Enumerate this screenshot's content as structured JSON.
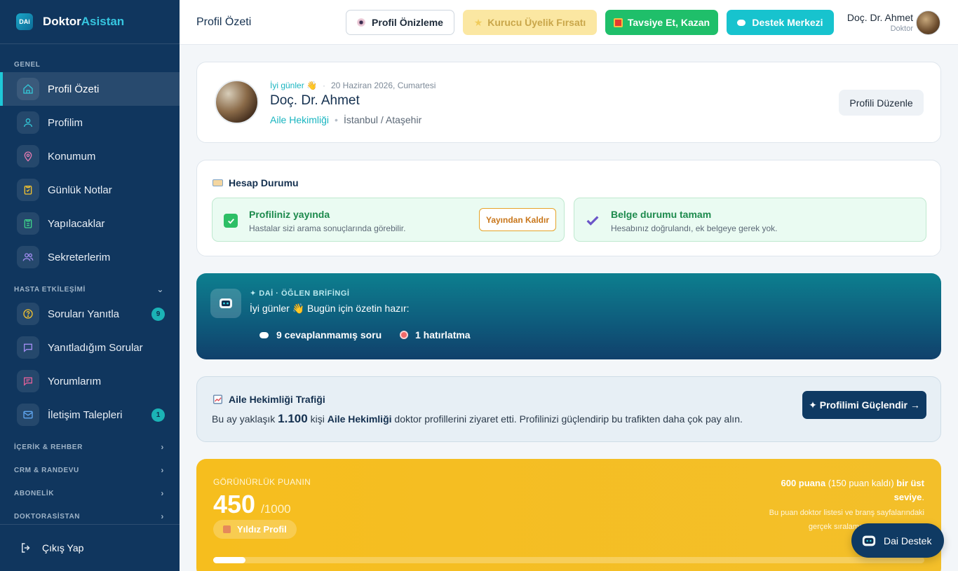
{
  "brand": {
    "logo_text": "DAi",
    "name_part1": "Doktor",
    "name_part2": "Asistan"
  },
  "sidebar": {
    "section_genel": "GENEL",
    "items_genel": [
      {
        "label": "Profil Özeti",
        "icon": "home-icon"
      },
      {
        "label": "Profilim",
        "icon": "user-icon"
      },
      {
        "label": "Konumum",
        "icon": "location-pin-icon"
      },
      {
        "label": "Günlük Notlar",
        "icon": "clipboard-check-icon"
      },
      {
        "label": "Yapılacaklar",
        "icon": "clipboard-list-icon"
      },
      {
        "label": "Sekreterlerim",
        "icon": "users-icon"
      }
    ],
    "section_hasta": "HASTA ETKİLEŞİMİ",
    "items_hasta": [
      {
        "label": "Soruları Yanıtla",
        "icon": "question-circle-icon",
        "badge": "9"
      },
      {
        "label": "Yanıtladığım Sorular",
        "icon": "chat-bubble-icon"
      },
      {
        "label": "Yorumlarım",
        "icon": "comment-icon"
      },
      {
        "label": "İletişim Talepleri",
        "icon": "mail-icon",
        "badge": "1"
      }
    ],
    "collapsed_sections": [
      "İÇERİK & REHBER",
      "CRM & RANDEVU",
      "ABONELİK",
      "DOKTORASİSTAN"
    ],
    "logout": "Çıkış Yap"
  },
  "topbar": {
    "title": "Profil Özeti",
    "btn_preview": "Profil Önizleme",
    "btn_founder": "Kurucu Üyelik Fırsatı",
    "btn_refer": "Tavsiye Et, Kazan",
    "btn_support": "Destek Merkezi",
    "user_name": "Doç. Dr. Ahmet",
    "user_role": "Doktor"
  },
  "profile": {
    "greeting": "İyi günler 👋",
    "date": "20 Haziran 2026, Cumartesi",
    "name": "Doç. Dr. Ahmet",
    "specialty": "Aile Hekimliği",
    "location": "İstanbul / Ataşehir",
    "edit_button": "Profili Düzenle"
  },
  "account": {
    "title": "Hesap Durumu",
    "published_title": "Profiliniz yayında",
    "published_desc": "Hastalar sizi arama sonuçlarında görebilir.",
    "unpublish_button": "Yayından Kaldır",
    "docs_title": "Belge durumu tamam",
    "docs_desc": "Hesabınız doğrulandı, ek belgeye gerek yok."
  },
  "briefing": {
    "label": "✦ DAİ · ÖĞLEN BRİFİNGİ",
    "text": "İyi günler 👋 Bugün için özetin hazır:",
    "stat1": "9 cevaplanmamış soru",
    "stat2": "1 hatırlatma"
  },
  "traffic": {
    "title": "Aile Hekimliği Trafiği",
    "text_1": "Bu ay yaklaşık ",
    "count": "1.100",
    "text_2": " kişi ",
    "specialty": "Aile Hekimliği",
    "text_3": " doktor profillerini ziyaret etti. Profilinizi güçlendirip bu trafikten daha çok pay alın.",
    "cta": "✦ Profilimi Güçlendir →"
  },
  "score": {
    "label": "GÖRÜNÜRLÜK PUANIN",
    "value": "450",
    "max": "/1000",
    "level": "Yıldız Profil",
    "next_points": "600 puana",
    "remaining": " (150 puan kaldı) ",
    "next_label": "bir üst seviye",
    "desc": "Bu puan doktor listesi ve branş sayfalarındaki gerçek sıralama puanınızı belirler.",
    "progress_fraction": 0.045
  },
  "dai_button": "Dai Destek",
  "colors": {
    "sidebar": "#10365e",
    "accent": "#1ec8d8",
    "teal": "#17c3ce",
    "green": "#1fbf6a",
    "gold": "#f5bd1f",
    "navy": "#0f3a63"
  }
}
